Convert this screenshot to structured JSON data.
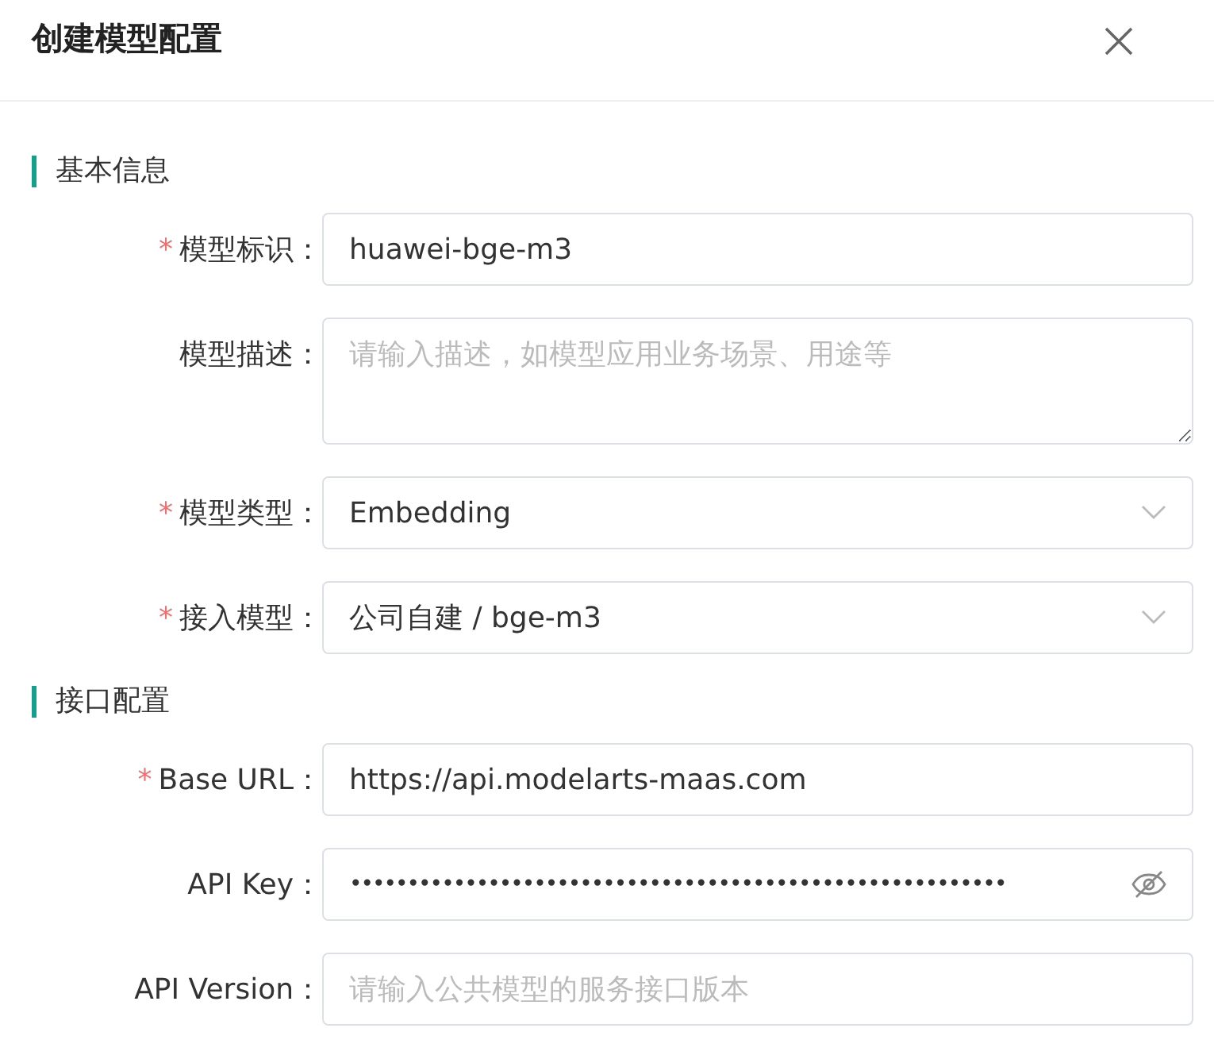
{
  "dialog": {
    "title": "创建模型配置"
  },
  "sections": [
    {
      "title": "基本信息",
      "fields": [
        {
          "label": "模型标识：",
          "marker": "*",
          "kind": "input",
          "value": "huawei-bge-m3"
        },
        {
          "label": "模型描述：",
          "kind": "textarea",
          "placeholder": "请输入描述，如模型应用业务场景、用途等"
        },
        {
          "label": "模型类型：",
          "marker": "*",
          "kind": "select",
          "value": "Embedding"
        },
        {
          "label": "接入模型：",
          "marker": "*",
          "kind": "select",
          "value": "公司自建 / bge-m3"
        }
      ]
    },
    {
      "title": "接口配置",
      "fields": [
        {
          "label": "Base URL：",
          "marker": "*",
          "kind": "input",
          "value": "https://api.modelarts-maas.com"
        },
        {
          "label": "API Key：",
          "kind": "password",
          "value": "•••••••••••••••••••••••••••••••••••••••••••••••••••••••••"
        },
        {
          "label": "API Version：",
          "kind": "input",
          "placeholder": "请输入公共模型的服务接口版本"
        }
      ]
    }
  ]
}
